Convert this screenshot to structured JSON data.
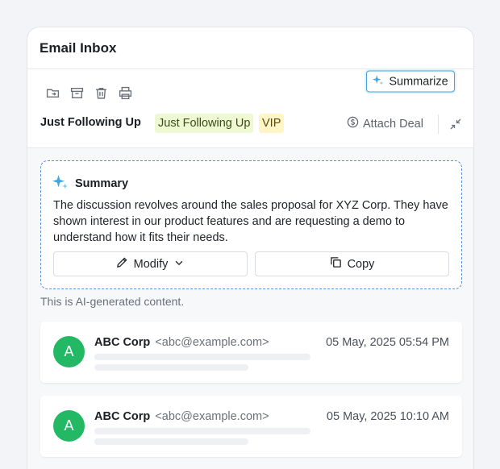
{
  "header": {
    "title": "Email Inbox"
  },
  "toolbar": {
    "icons": [
      "move-to-folder-icon",
      "archive-icon",
      "trash-icon",
      "print-icon"
    ],
    "summarize_label": "Summarize"
  },
  "subject": {
    "title": "Just Following Up",
    "tags": [
      {
        "label": "Just Following Up",
        "color": "#eef9d4"
      },
      {
        "label": "VIP",
        "color": "#fff5c7"
      }
    ],
    "attach_deal_label": "Attach Deal"
  },
  "summary": {
    "title": "Summary",
    "text": "The discussion revolves around the sales proposal for XYZ Corp. They have shown interest in our product features and are requesting a demo to understand how it fits their needs.",
    "modify_label": "Modify",
    "copy_label": "Copy",
    "ai_note": "This is AI-generated content."
  },
  "messages": [
    {
      "avatar": "A",
      "name": "ABC Corp",
      "email": "<abc@example.com>",
      "date": "05 May, 2025  05:54 PM"
    },
    {
      "avatar": "A",
      "name": "ABC Corp",
      "email": "<abc@example.com>",
      "date": "05 May, 2025  10:10 AM"
    }
  ],
  "colors": {
    "accent": "#3fa6df",
    "avatar": "#22b864",
    "dashed_border": "#5b8fd8"
  }
}
